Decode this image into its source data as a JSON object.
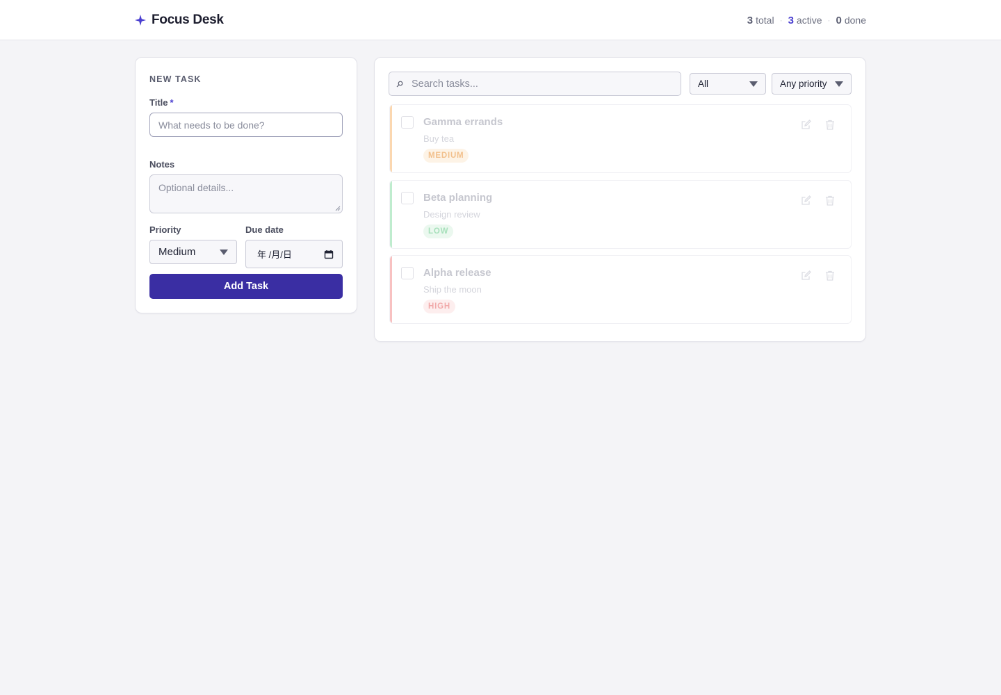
{
  "app": {
    "name": "Focus Desk",
    "icon": "sparkle-icon",
    "accent_color": "#4a3fd0"
  },
  "stats": {
    "total_count": "3",
    "total_label": "total",
    "active_count": "3",
    "active_label": "active",
    "done_count": "0",
    "done_label": "done",
    "separator": "·"
  },
  "new_task": {
    "section_title": "NEW TASK",
    "title_label": "Title",
    "required_mark": "*",
    "title_placeholder": "What needs to be done?",
    "title_value": "",
    "notes_label": "Notes",
    "notes_placeholder": "Optional details...",
    "notes_value": "",
    "priority_label": "Priority",
    "priority_value": "Medium",
    "due_label": "Due date",
    "due_value": "年 /月/日",
    "submit_label": "Add Task",
    "submit_color": "#3a2ea3"
  },
  "list": {
    "search_placeholder": "Search tasks...",
    "search_value": "",
    "status_filter": "All",
    "priority_filter": "Any priority",
    "tasks": [
      {
        "title": "Gamma errands",
        "notes": "Buy tea",
        "priority": "MEDIUM",
        "bar_color": "#fbd7b0",
        "badge_bg": "#fdf3e6",
        "badge_fg": "#f2c08c",
        "done": false
      },
      {
        "title": "Beta planning",
        "notes": "Design review",
        "priority": "LOW",
        "bar_color": "#bfecce",
        "badge_bg": "#ebf8ef",
        "badge_fg": "#a7e0bb",
        "done": false
      },
      {
        "title": "Alpha release",
        "notes": "Ship the moon",
        "priority": "HIGH",
        "bar_color": "#f8c1c1",
        "badge_bg": "#fdeeee",
        "badge_fg": "#f1a9a9",
        "done": false
      }
    ]
  }
}
